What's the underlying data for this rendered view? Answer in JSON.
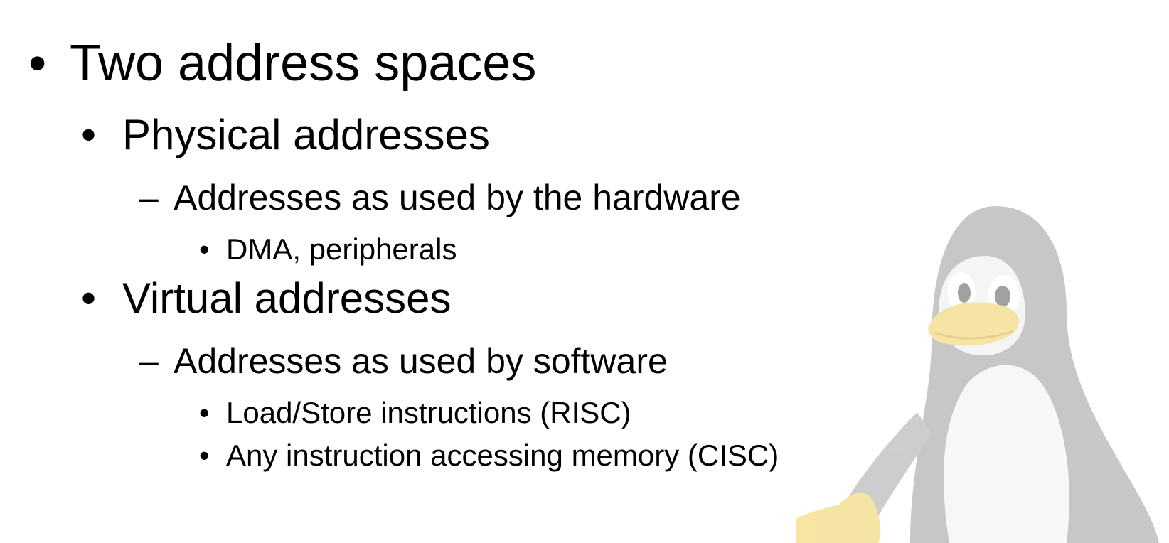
{
  "slide": {
    "items": [
      {
        "marker": "•",
        "text": "Two address spaces"
      },
      {
        "marker": "•",
        "text": "Physical addresses"
      },
      {
        "marker": "–",
        "text": "Addresses as used by the hardware"
      },
      {
        "marker": "•",
        "text": "DMA, peripherals"
      },
      {
        "marker": "•",
        "text": "Virtual addresses"
      },
      {
        "marker": "–",
        "text": "Addresses as used by software"
      },
      {
        "marker": "•",
        "text": "Load/Store instructions (RISC)"
      },
      {
        "marker": "•",
        "text": "Any instruction accessing memory (CISC)"
      }
    ]
  },
  "colors": {
    "text": "#000000",
    "background": "#ffffff",
    "watermark_body": "#cfcfcf",
    "watermark_beak": "#f3d46a"
  },
  "watermark": {
    "icon": "tux-penguin-icon"
  }
}
